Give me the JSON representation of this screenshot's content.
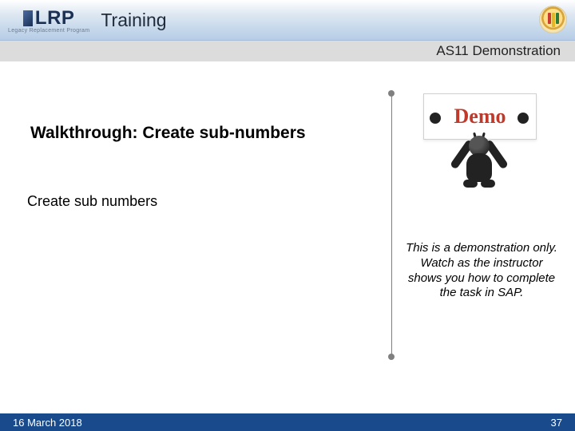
{
  "header": {
    "logo_text": "LRP",
    "logo_subtext": "Legacy Replacement Program",
    "title": "Training"
  },
  "section": {
    "label": "AS11 Demonstration"
  },
  "main": {
    "walkthrough_heading": "Walkthrough: Create sub-numbers",
    "step_text": "Create sub numbers",
    "demo_label": "Demo",
    "note": "This is a demonstration only. Watch as the instructor shows you how to complete the task in SAP."
  },
  "footer": {
    "date": "16 March 2018",
    "page_number": "37"
  }
}
